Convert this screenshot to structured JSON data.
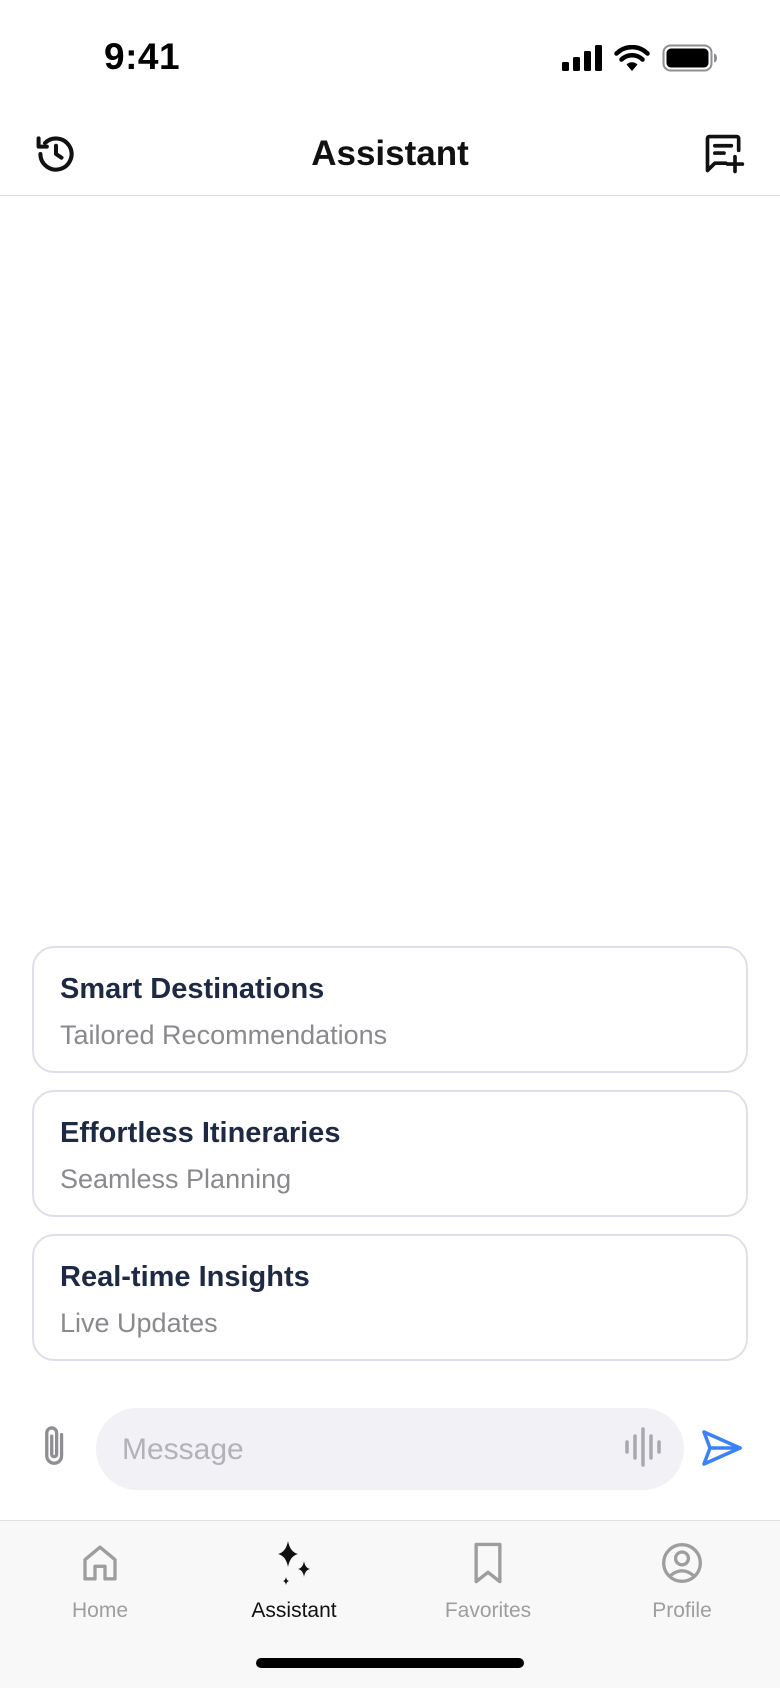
{
  "status_bar": {
    "time": "9:41",
    "icons": [
      "cellular-signal-icon",
      "wifi-icon",
      "battery-icon"
    ]
  },
  "header": {
    "title": "Assistant",
    "left_icon": "history-icon",
    "right_icon": "new-chat-icon"
  },
  "suggestions": [
    {
      "title": "Smart Destinations",
      "subtitle": "Tailored Recommendations"
    },
    {
      "title": "Effortless Itineraries",
      "subtitle": "Seamless Planning"
    },
    {
      "title": "Real-time Insights",
      "subtitle": "Live Updates"
    }
  ],
  "composer": {
    "placeholder": "Message",
    "value": "",
    "attach_icon": "paperclip-icon",
    "voice_icon": "waveform-icon",
    "send_icon": "send-icon"
  },
  "tab_bar": {
    "active": "Assistant",
    "tabs": [
      {
        "label": "Home",
        "icon": "home-icon"
      },
      {
        "label": "Assistant",
        "icon": "sparkles-icon"
      },
      {
        "label": "Favorites",
        "icon": "bookmark-icon"
      },
      {
        "label": "Profile",
        "icon": "profile-icon"
      }
    ]
  },
  "colors": {
    "accent": "#3b82f6",
    "card_border": "#dde0ea",
    "card_title": "#1e2a44",
    "muted_text": "#8a8a8e",
    "input_background": "#f1f1f6",
    "tab_inactive": "#9e9e9e"
  }
}
